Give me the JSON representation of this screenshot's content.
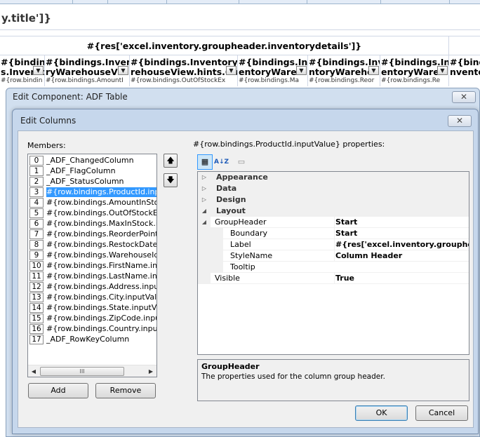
{
  "sheet": {
    "title_cell": "y.title']}",
    "group_header": "#{res['excel.inventory.groupheader.inventorydetails']}",
    "column_headers": [
      {
        "line1": "#{binding",
        "line2": "s.Invento"
      },
      {
        "line1": "#{bindings.Invento",
        "line2": "ryWarehouseVie"
      },
      {
        "line1": "#{bindings.InventoryWa",
        "line2": "rehouseView.hints.Ou"
      },
      {
        "line1": "#{bindings.Inv",
        "line2": "entoryWareh"
      },
      {
        "line1": "#{bindings.Inve",
        "line2": "ntoryWarehou"
      },
      {
        "line1": "#{bindings.Inv",
        "line2": "entoryWareh"
      },
      {
        "line1": "#{binding",
        "line2": "nventoryW"
      }
    ],
    "hint_row": [
      "#{row.bindin",
      "#{row.bindings.AmountI",
      "#{row.bindings.OutOfStockEx",
      "#{row.bindings.Ma",
      "#{row.bindings.Reor",
      "#{row.bindings.Re",
      ""
    ]
  },
  "outer_dialog": {
    "title": "Edit Component: ADF Table",
    "close_glyph": "✕"
  },
  "inner_dialog": {
    "title": "Edit Columns",
    "close_glyph": "✕",
    "members_label": "Members:",
    "members": [
      {
        "index": "0",
        "name": "_ADF_ChangedColumn"
      },
      {
        "index": "1",
        "name": "_ADF_FlagColumn"
      },
      {
        "index": "2",
        "name": "_ADF_StatusColumn"
      },
      {
        "index": "3",
        "name": "#{row.bindings.ProductId.inputV"
      },
      {
        "index": "4",
        "name": "#{row.bindings.AmountInStock.i"
      },
      {
        "index": "5",
        "name": "#{row.bindings.OutOfStockExpl."
      },
      {
        "index": "6",
        "name": "#{row.bindings.MaxInStock.inpu"
      },
      {
        "index": "7",
        "name": "#{row.bindings.ReorderPoint.inp"
      },
      {
        "index": "8",
        "name": "#{row.bindings.RestockDate.inp"
      },
      {
        "index": "9",
        "name": "#{row.bindings.WarehouseId.inp"
      },
      {
        "index": "10",
        "name": "#{row.bindings.FirstName.input"
      },
      {
        "index": "11",
        "name": "#{row.bindings.LastName.input\\"
      },
      {
        "index": "12",
        "name": "#{row.bindings.Address.inputVa"
      },
      {
        "index": "13",
        "name": "#{row.bindings.City.inputValue}"
      },
      {
        "index": "14",
        "name": "#{row.bindings.State.inputValue"
      },
      {
        "index": "15",
        "name": "#{row.bindings.ZipCode.inputVal"
      },
      {
        "index": "16",
        "name": "#{row.bindings.Country.inputVal"
      },
      {
        "index": "17",
        "name": "_ADF_RowKeyColumn"
      }
    ],
    "selected_member_index": 3,
    "scroll_left": "◀",
    "scroll_right": "▶",
    "scroll_thumb_grip": "III",
    "move_up_glyph": "🡅",
    "move_down_glyph": "🡇",
    "add_label": "Add",
    "remove_label": "Remove",
    "properties_label": "#{row.bindings.ProductId.inputValue} properties:",
    "toolbar": {
      "categorized_glyph": "▦",
      "alphabetical_glyph": "A↓Z",
      "pages_glyph": "▭"
    },
    "properties": [
      {
        "kind": "category",
        "name": "Appearance",
        "expander": "▷"
      },
      {
        "kind": "category",
        "name": "Data",
        "expander": "▷"
      },
      {
        "kind": "category",
        "name": "Design",
        "expander": "▷"
      },
      {
        "kind": "category",
        "name": "Layout",
        "expander": "◢"
      },
      {
        "kind": "group",
        "name": "GroupHeader",
        "value": "Start",
        "expander": "◢"
      },
      {
        "kind": "sub",
        "name": "Boundary",
        "value": "Start"
      },
      {
        "kind": "sub",
        "name": "Label",
        "value": "#{res['excel.inventory.groupheader"
      },
      {
        "kind": "sub",
        "name": "StyleName",
        "value": "Column Header"
      },
      {
        "kind": "sub",
        "name": "Tooltip",
        "value": ""
      },
      {
        "kind": "prop",
        "name": "Visible",
        "value": "True"
      }
    ],
    "description": {
      "title": "GroupHeader",
      "text": "The properties used for the column group header."
    },
    "ok_label": "OK",
    "cancel_label": "Cancel"
  }
}
